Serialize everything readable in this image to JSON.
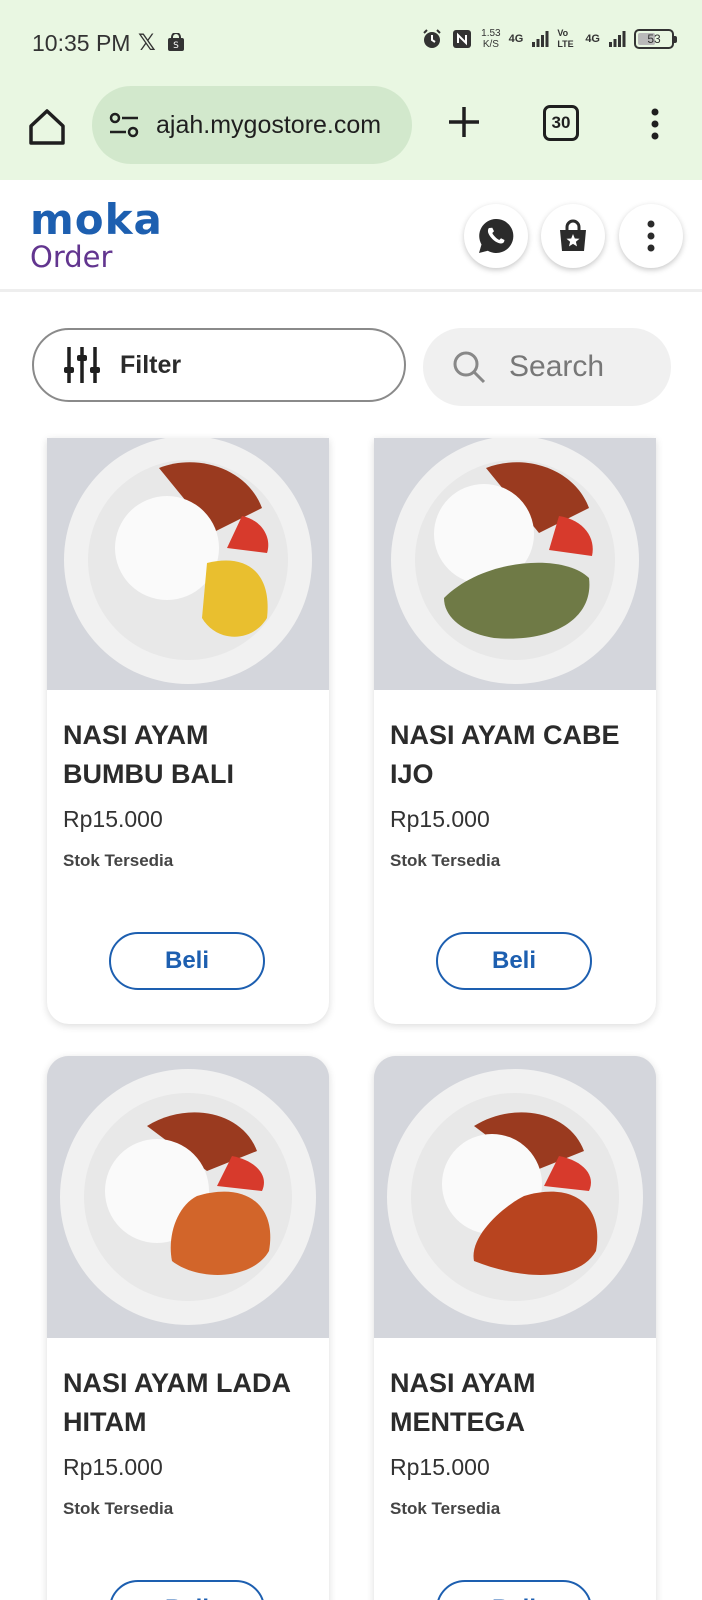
{
  "status_bar": {
    "time": "10:35 PM",
    "speed_value": "1.53",
    "speed_unit": "K/S",
    "net1": "4G",
    "net_volte": "Vo LTE",
    "net2": "4G",
    "battery": "53"
  },
  "browser": {
    "url": "ajah.mygostore.com",
    "tab_count": "30"
  },
  "header": {
    "logo_top": "moka",
    "logo_bottom": "Order"
  },
  "filter": {
    "label": "Filter"
  },
  "search": {
    "placeholder": "Search"
  },
  "products": [
    {
      "name": "NASI AYAM BUMBU BALI",
      "price": "Rp15.000",
      "stock": "Stok Tersedia",
      "button": "Beli",
      "side_color": "#e9bf2f"
    },
    {
      "name": "NASI AYAM CABE IJO",
      "price": "Rp15.000",
      "stock": "Stok Tersedia",
      "button": "Beli",
      "side_color": "#6f7a46"
    },
    {
      "name": "NASI AYAM LADA HITAM",
      "price": "Rp15.000",
      "stock": "Stok Tersedia",
      "button": "Beli",
      "side_color": "#d2652a"
    },
    {
      "name": "NASI AYAM MENTEGA",
      "price": "Rp15.000",
      "stock": "Stok Tersedia",
      "button": "Beli",
      "side_color": "#b8441f"
    }
  ],
  "colors": {
    "brand_blue": "#1d5fb0",
    "brand_purple": "#62358f",
    "chrome_bg": "#e9f7e2",
    "urlbar_bg": "#d2e8cc"
  }
}
